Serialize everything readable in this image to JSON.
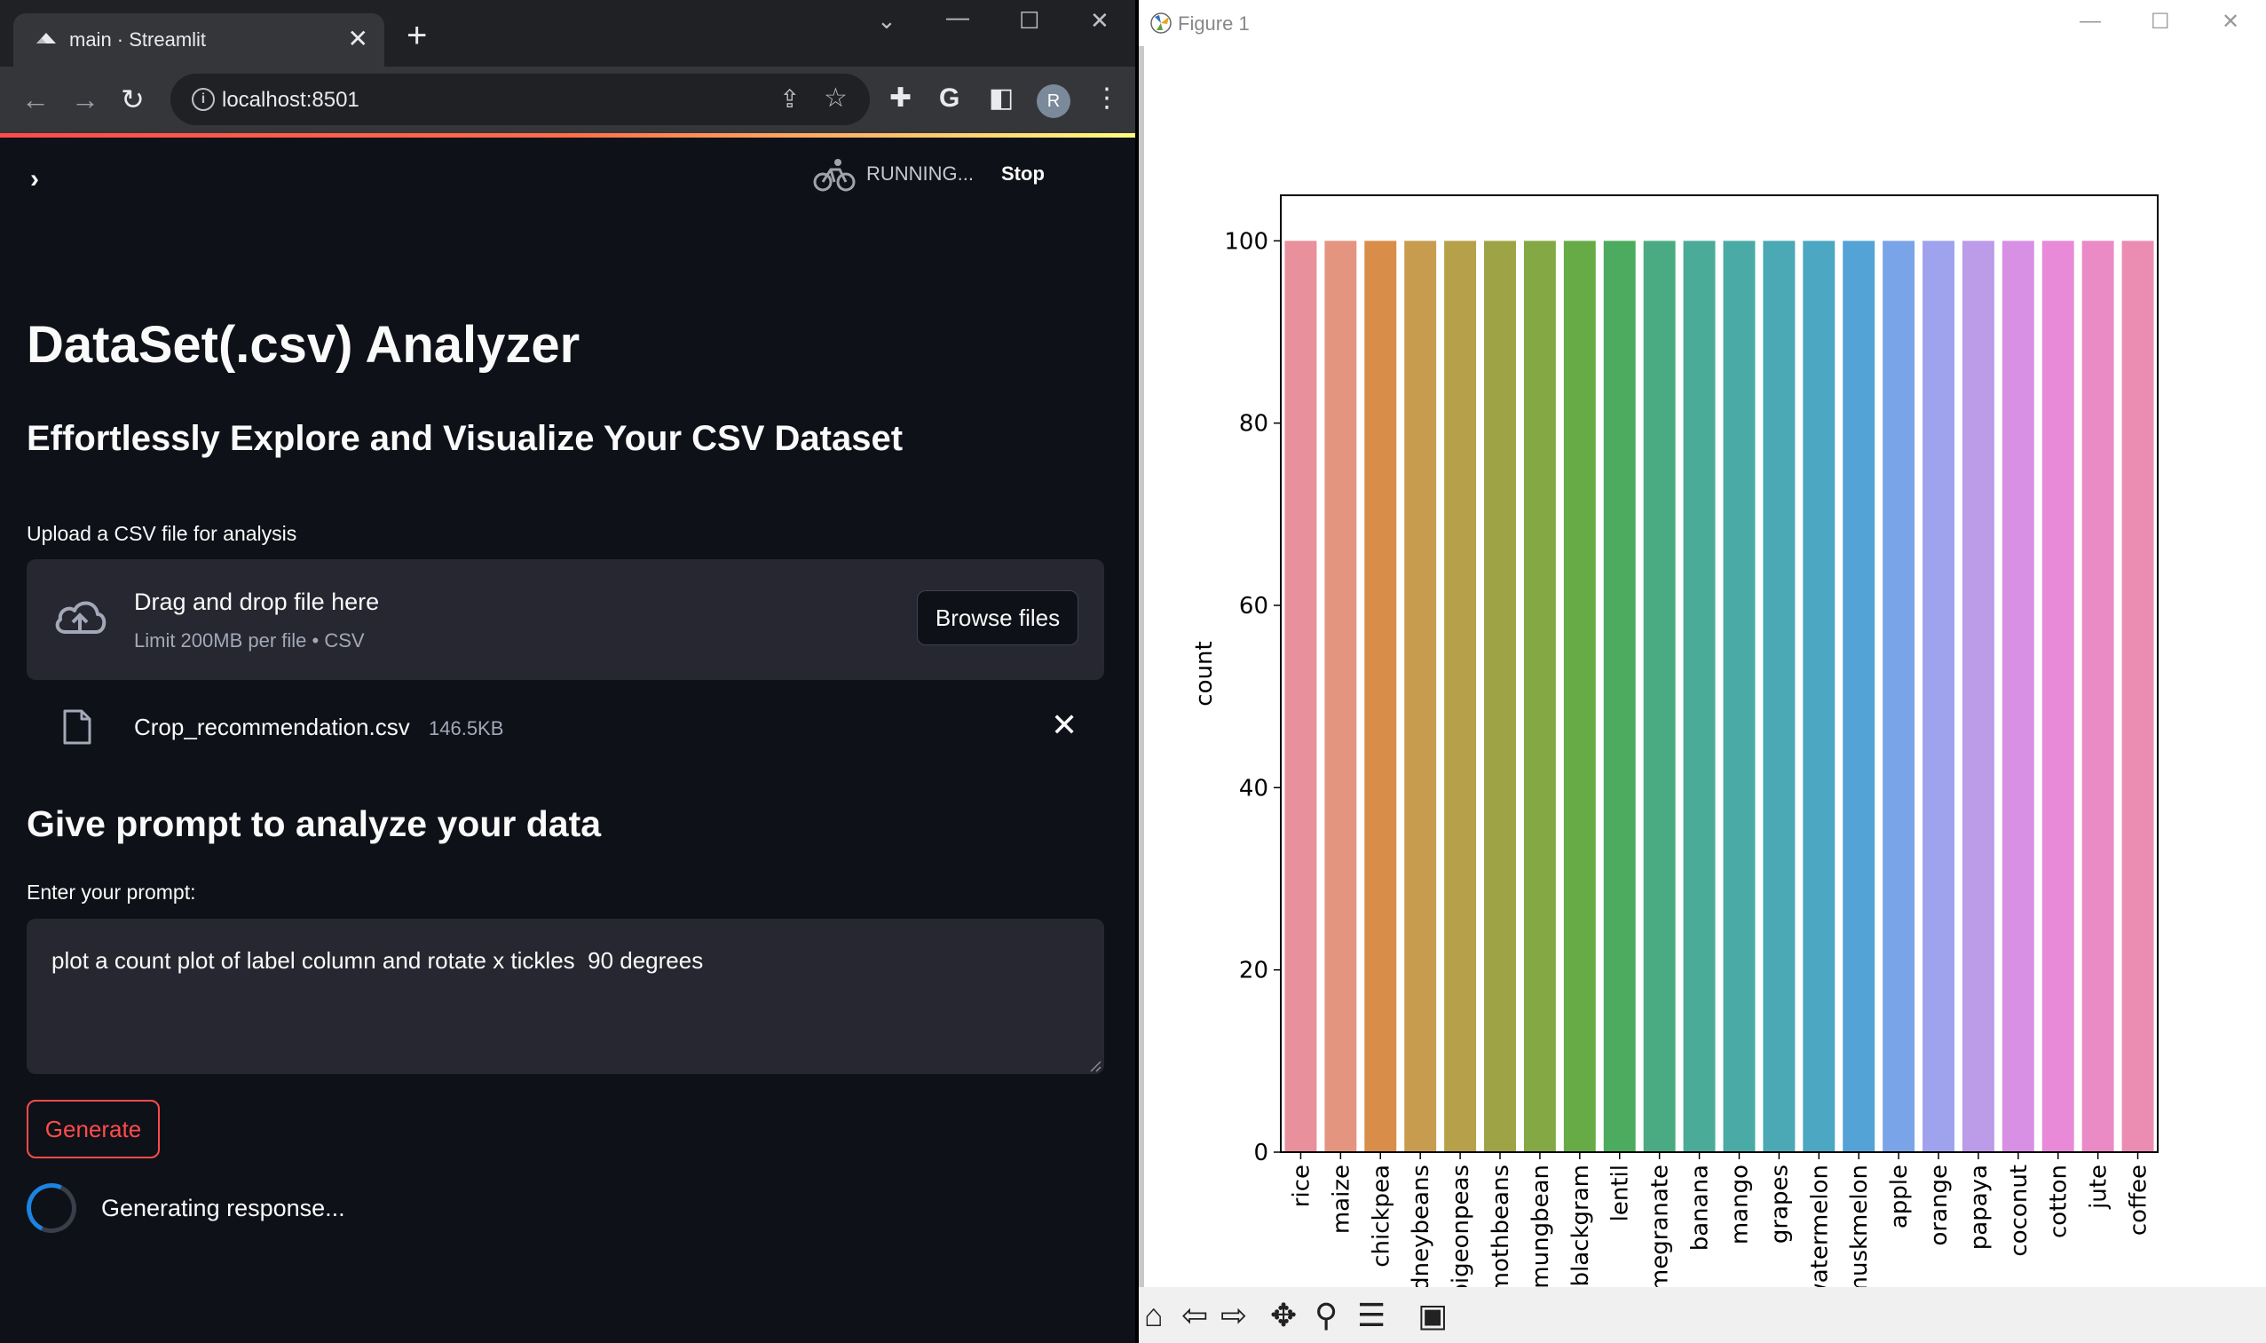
{
  "browser": {
    "tab_title": "main · Streamlit",
    "new_tab_label": "+",
    "url": "localhost:8501",
    "avatar_letter": "R"
  },
  "streamlit": {
    "status": "RUNNING...",
    "stop_label": "Stop",
    "title": "DataSet(.csv) Analyzer",
    "subtitle": "Effortlessly Explore and Visualize Your CSV Dataset",
    "upload_label": "Upload a CSV file for analysis",
    "drop_title": "Drag and drop file here",
    "drop_limit": "Limit 200MB per file • CSV",
    "browse_label": "Browse files",
    "file_name": "Crop_recommendation.csv",
    "file_size": "146.5KB",
    "prompt_heading": "Give prompt to analyze your data",
    "prompt_label": "Enter your prompt:",
    "prompt_value": "plot a count plot of label column and rotate x tickles  90 degrees",
    "generate_label": "Generate",
    "generating_text": "Generating response..."
  },
  "figure": {
    "window_title": "Figure 1"
  },
  "chart_data": {
    "type": "bar",
    "title": "",
    "xlabel": "",
    "ylabel": "count",
    "ylim": [
      0,
      105
    ],
    "yticks": [
      0,
      20,
      40,
      60,
      80,
      100
    ],
    "categories": [
      "rice",
      "maize",
      "chickpea",
      "kidneybeans",
      "pigeonpeas",
      "mothbeans",
      "mungbean",
      "blackgram",
      "lentil",
      "pomegranate",
      "banana",
      "mango",
      "grapes",
      "watermelon",
      "muskmelon",
      "apple",
      "orange",
      "papaya",
      "coconut",
      "cotton",
      "jute",
      "coffee"
    ],
    "values": [
      100,
      100,
      100,
      100,
      100,
      100,
      100,
      100,
      100,
      100,
      100,
      100,
      100,
      100,
      100,
      100,
      100,
      100,
      100,
      100,
      100,
      100
    ],
    "colors": [
      "#e8909b",
      "#e49580",
      "#d88d48",
      "#c89c4f",
      "#b6a04a",
      "#9ea345",
      "#84a844",
      "#67ab46",
      "#4cab5e",
      "#4aab83",
      "#4aac98",
      "#4aaaa6",
      "#4aa9b4",
      "#4ca7c3",
      "#54a3d6",
      "#7aa4e8",
      "#9fa3ee",
      "#bc9be9",
      "#d790e4",
      "#e88ad8",
      "#ea8bc6",
      "#eb8db2"
    ],
    "grid": false,
    "legend": "none"
  }
}
